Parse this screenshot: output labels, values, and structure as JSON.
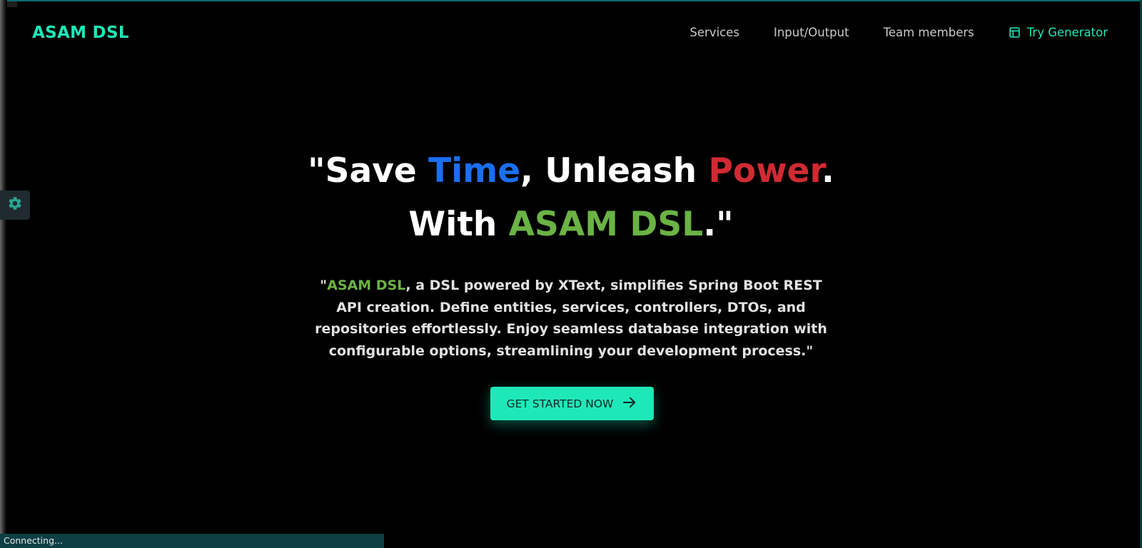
{
  "colors": {
    "accent": "#1fe8b8",
    "blue": "#1a6ff2",
    "red": "#d12a33",
    "green": "#6ab344"
  },
  "header": {
    "brand": "ASAM DSL",
    "nav": {
      "services": "Services",
      "io": "Input/Output",
      "team": "Team members",
      "try_generator": "Try Generator"
    }
  },
  "hero": {
    "title_parts": {
      "p1": "\"Save ",
      "time": "Time",
      "p2": ", Unleash ",
      "power": "Power",
      "p3": ".",
      "p4": "With ",
      "brand": "ASAM DSL",
      "p5": ".\""
    },
    "description": {
      "open_quote": "\"",
      "brand": "ASAM DSL",
      "rest": ", a DSL powered by XText, simplifies Spring Boot REST API creation. Define entities, services, controllers, DTOs, and repositories effortlessly. Enjoy seamless database integration with configurable options, streamlining your development process.\""
    },
    "cta_label": "GET STARTED NOW"
  },
  "status": {
    "text": "Connecting..."
  },
  "icons": {
    "settings": "gear-icon",
    "try_generator": "layout-icon",
    "cta": "arrow-right-icon"
  }
}
